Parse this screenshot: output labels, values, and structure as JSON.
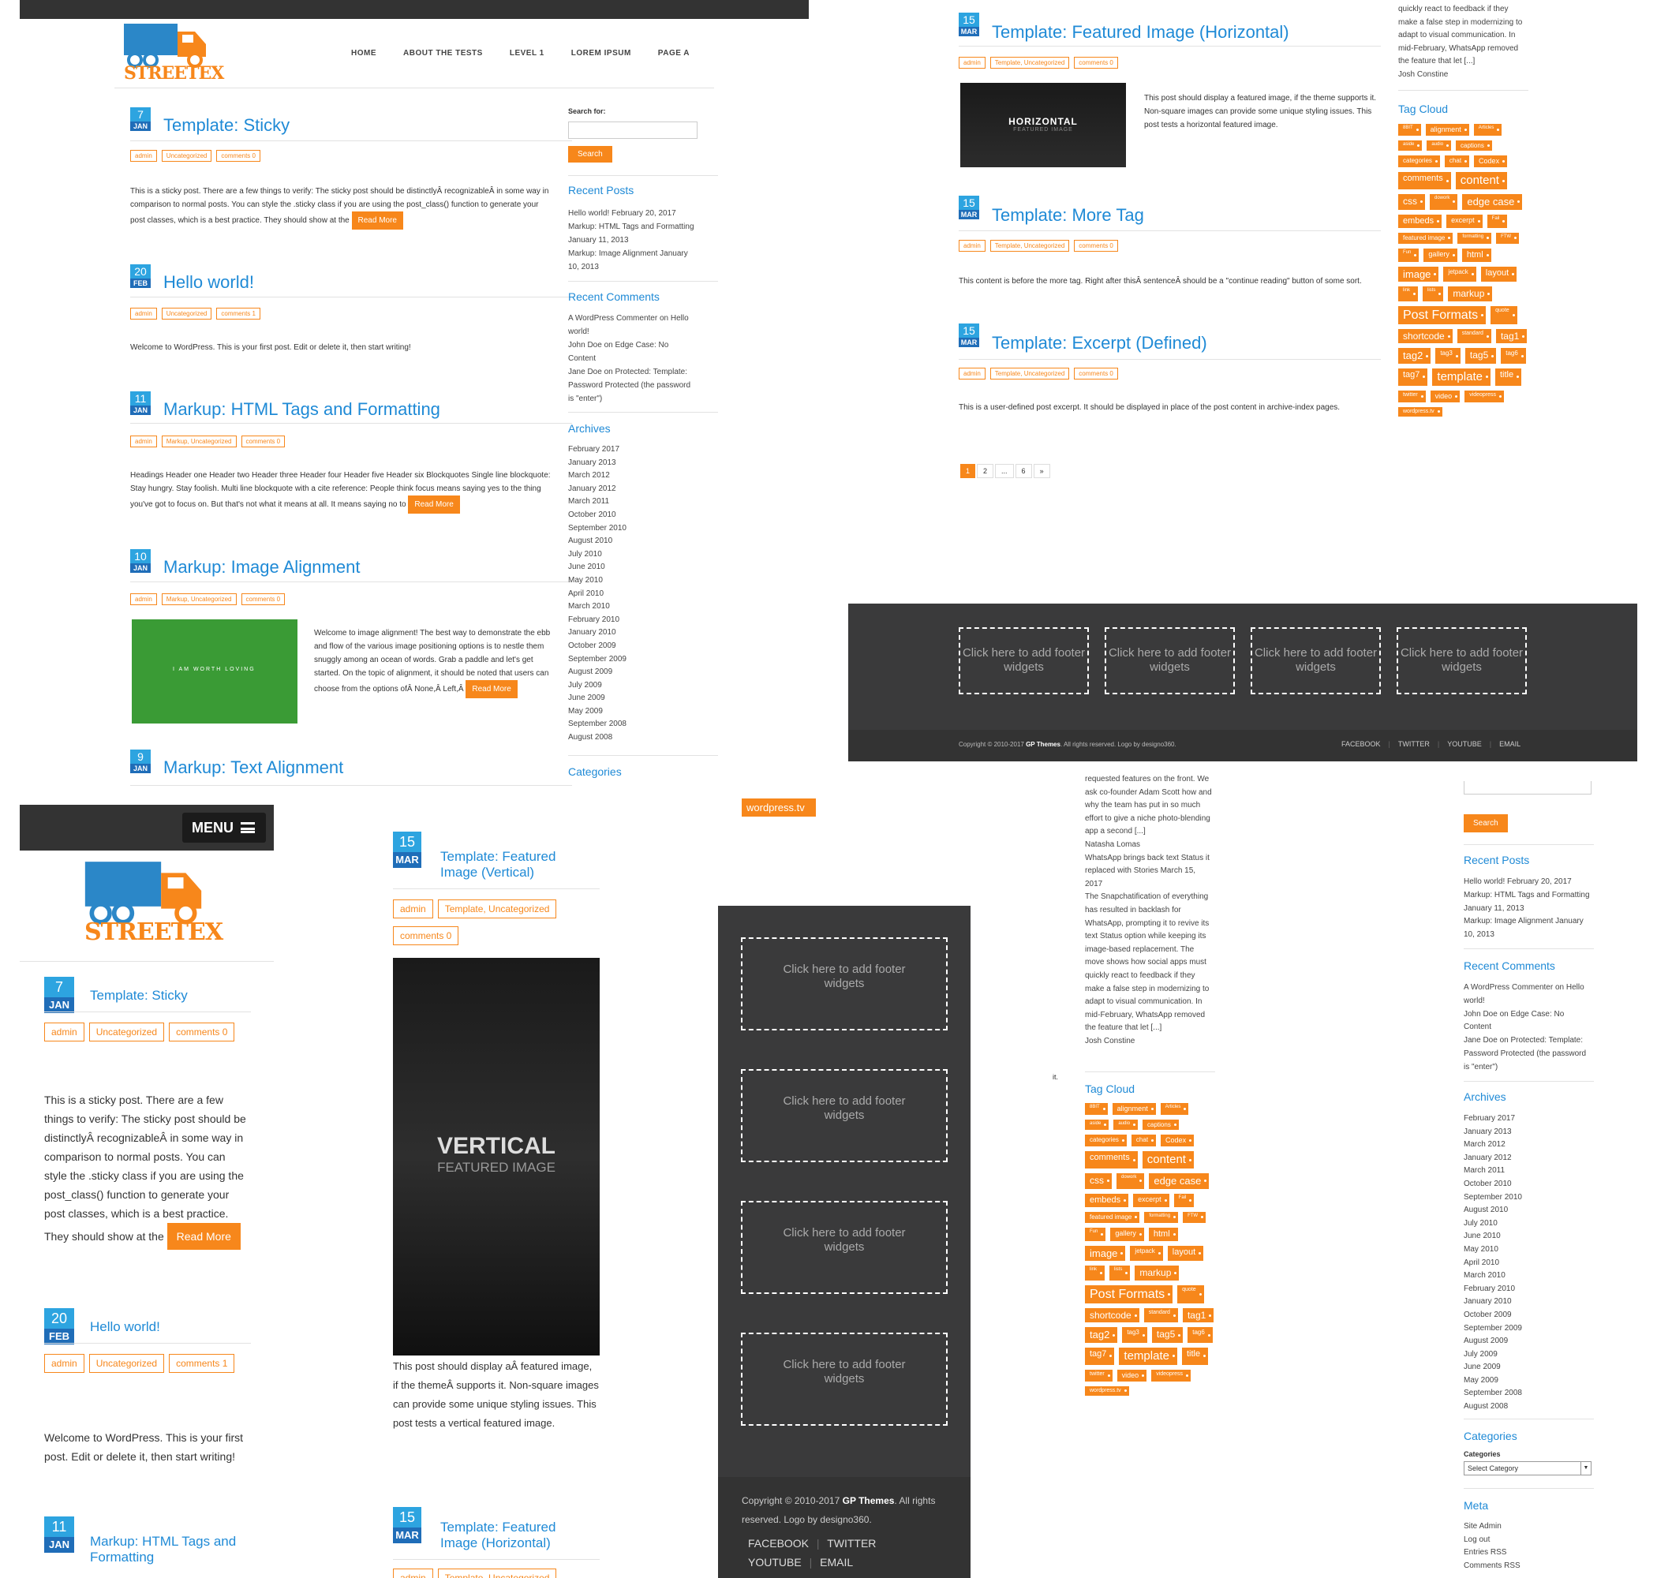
{
  "panel1": {
    "logo_text": "STREETEX",
    "nav": [
      "HOME",
      "ABOUT THE TESTS",
      "LEVEL 1",
      "LOREM IPSUM",
      "PAGE A"
    ],
    "posts": [
      {
        "day": "7",
        "month": "JAN",
        "title": "Template: Sticky",
        "meta": [
          "admin",
          "Uncategorized",
          "comments 0"
        ],
        "excerpt": "This is a sticky post. There are a few things to verify: The sticky post should be distinctlyÂ recognizableÂ in some way in comparison to normal posts. You can style the .sticky class if you are using the post_class() function to generate your post classes, which is a best practice. They should show at the",
        "more": "Read More"
      },
      {
        "day": "20",
        "month": "FEB",
        "title": "Hello world!",
        "meta": [
          "admin",
          "Uncategorized",
          "comments 1"
        ],
        "excerpt": "Welcome to WordPress. This is your first post. Edit or delete it, then start writing!",
        "more": ""
      },
      {
        "day": "11",
        "month": "JAN",
        "title": "Markup: HTML Tags and Formatting",
        "meta": [
          "admin",
          "Markup, Uncategorized",
          "comments 0"
        ],
        "excerpt": "Headings Header one Header two Header three Header four Header five Header six Blockquotes Single line blockquote: Stay hungry. Stay foolish. Multi line blockquote with a cite reference: People think focus means saying yes to the thing you've got to focus on. But that's not what it means at all. It means saying no to",
        "more": "Read More"
      },
      {
        "day": "10",
        "month": "JAN",
        "title": "Markup: Image Alignment",
        "meta": [
          "admin",
          "Markup, Uncategorized",
          "comments 0"
        ],
        "excerpt": "Welcome to image alignment! The best way to demonstrate the ebb and flow of the various image positioning options is to nestle them snuggly among an ocean of words. Grab a paddle and let's get started. On the topic of alignment, it should be noted that users can choose from the options ofÂ None,Â Left,Â",
        "more": "Read More",
        "image_text": "I AM WORTH LOVING"
      },
      {
        "day": "9",
        "month": "JAN",
        "title": "Markup: Text Alignment"
      }
    ],
    "sidebar": {
      "search_label": "Search for:",
      "search_button": "Search",
      "recent_posts_title": "Recent Posts",
      "recent_posts": [
        "Hello world! February 20, 2017",
        "Markup: HTML Tags and Formatting",
        "January 11, 2013",
        "Markup: Image Alignment January",
        "10, 2013"
      ],
      "recent_comments_title": "Recent Comments",
      "recent_comments": [
        "A WordPress Commenter on Hello",
        "world!",
        "John Doe on Edge Case: No",
        "Content",
        "Jane Doe on Protected: Template:",
        "Password Protected (the password",
        "is \"enter\")"
      ],
      "archives_title": "Archives",
      "archives": [
        "February 2017",
        "January 2013",
        "March 2012",
        "January 2012",
        "March 2011",
        "October 2010",
        "September 2010",
        "August 2010",
        "July 2010",
        "June 2010",
        "May 2010",
        "April 2010",
        "March 2010",
        "February 2010",
        "January 2010",
        "October 2009",
        "September 2009",
        "August 2009",
        "July 2009",
        "June 2009",
        "May 2009",
        "September 2008",
        "August 2008"
      ],
      "categories_title": "Categories"
    }
  },
  "panel2": {
    "posts": [
      {
        "day": "15",
        "month": "MAR",
        "title": "Template: Featured Image (Horizontal)",
        "meta": [
          "admin",
          "Template, Uncategorized",
          "comments 0"
        ],
        "excerpt": "This post should display a featured image, if the theme supports it. Non-square images can provide some unique styling issues. This post tests a horizontal featured image.",
        "image_title": "HORIZONTAL",
        "image_sub": "FEATURED IMAGE"
      },
      {
        "day": "15",
        "month": "MAR",
        "title": "Template: More Tag",
        "meta": [
          "admin",
          "Template, Uncategorized",
          "comments 0"
        ],
        "excerpt": "This content is before the more tag. Right after thisÂ sentenceÂ should be a \"continue reading\" button of some sort."
      },
      {
        "day": "15",
        "month": "MAR",
        "title": "Template: Excerpt (Defined)",
        "meta": [
          "admin",
          "Template, Uncategorized",
          "comments 0"
        ],
        "excerpt": "This is a user-defined post excerpt. It should be displayed in place of the post content in archive-index pages."
      }
    ],
    "pagination": [
      "1",
      "2",
      "...",
      "6",
      "»"
    ],
    "rss_tail": [
      "quickly react to feedback if they",
      "make a false step in modernizing to",
      "adapt to visual communication. In",
      "mid-February, WhatsApp removed",
      "the feature that let [...]",
      "Josh Constine"
    ],
    "tag_cloud_title": "Tag Cloud"
  },
  "tags": [
    {
      "t": "8BIT",
      "s": 6
    },
    {
      "t": "alignment",
      "s": 9
    },
    {
      "t": "Articles",
      "s": 6
    },
    {
      "t": "aside",
      "s": 6
    },
    {
      "t": "audio",
      "s": 6
    },
    {
      "t": "captions",
      "s": 8
    },
    {
      "t": "categories",
      "s": 8
    },
    {
      "t": "chat",
      "s": 8
    },
    {
      "t": "Codex",
      "s": 9
    },
    {
      "t": "comments",
      "s": 11
    },
    {
      "t": "content",
      "s": 15
    },
    {
      "t": "css",
      "s": 12
    },
    {
      "t": "dowork",
      "s": 6
    },
    {
      "t": "edge case",
      "s": 13
    },
    {
      "t": "embeds",
      "s": 11
    },
    {
      "t": "excerpt",
      "s": 9
    },
    {
      "t": "Fail",
      "s": 6
    },
    {
      "t": "featured image",
      "s": 8
    },
    {
      "t": "formatting",
      "s": 6
    },
    {
      "t": "FTW",
      "s": 6
    },
    {
      "t": "Fun",
      "s": 6
    },
    {
      "t": "gallery",
      "s": 9
    },
    {
      "t": "html",
      "s": 11
    },
    {
      "t": "image",
      "s": 13
    },
    {
      "t": "jetpack",
      "s": 8
    },
    {
      "t": "layout",
      "s": 11
    },
    {
      "t": "link",
      "s": 6
    },
    {
      "t": "lists",
      "s": 6
    },
    {
      "t": "markup",
      "s": 12
    },
    {
      "t": "Post Formats",
      "s": 16
    },
    {
      "t": "quote",
      "s": 7
    },
    {
      "t": "shortcode",
      "s": 12
    },
    {
      "t": "standard",
      "s": 7
    },
    {
      "t": "tag1",
      "s": 12
    },
    {
      "t": "tag2",
      "s": 13
    },
    {
      "t": "tag3",
      "s": 8
    },
    {
      "t": "tag5",
      "s": 12
    },
    {
      "t": "tag6",
      "s": 8
    },
    {
      "t": "tag7",
      "s": 11
    },
    {
      "t": "template",
      "s": 15
    },
    {
      "t": "title",
      "s": 11
    },
    {
      "t": "twitter",
      "s": 7
    },
    {
      "t": "video",
      "s": 9
    },
    {
      "t": "videopress",
      "s": 7
    },
    {
      "t": "wordpress.tv",
      "s": 7
    }
  ],
  "footer": {
    "widget_text": "Click here to add footer widgets",
    "copyright_pre": "Copyright © 2010-2017",
    "copyright_brand": "GP Themes",
    "copyright_post": ". All rights reserved. Logo by designo360.",
    "social": [
      "FACEBOOK",
      "TWITTER",
      "YOUTUBE",
      "EMAIL"
    ]
  },
  "panel3": {
    "menu_label": "MENU",
    "posts": [
      {
        "day": "7",
        "month": "JAN",
        "title": "Template: Sticky",
        "meta": [
          "admin",
          "Uncategorized",
          "comments 0"
        ],
        "excerpt": "This is a sticky post. There are a few things to verify: The sticky post should be distinctlyÂ recognizableÂ in some way in comparison to normal posts. You can style the .sticky class if you are using the post_class() function to generate your post classes, which is a best practice. They should show at the",
        "more": "Read More"
      },
      {
        "day": "20",
        "month": "FEB",
        "title": "Hello world!",
        "meta": [
          "admin",
          "Uncategorized",
          "comments 1"
        ],
        "excerpt": "Welcome to WordPress. This is your first post. Edit or delete it, then start writing!"
      },
      {
        "day": "11",
        "month": "JAN",
        "title": "Markup: HTML Tags and Formatting"
      }
    ]
  },
  "panel4": {
    "posts": [
      {
        "day": "15",
        "month": "MAR",
        "title": "Template: Featured Image (Vertical)",
        "meta": [
          "admin",
          "Template, Uncategorized",
          "comments 0"
        ],
        "excerpt": "This post should display aÂ featured image, if the themeÂ supports it. Non-square images can provide some unique styling issues. This post tests a vertical featured image.",
        "image_title": "VERTICAL",
        "image_sub": "FEATURED IMAGE"
      },
      {
        "day": "15",
        "month": "MAR",
        "title": "Template: Featured Image (Horizontal)",
        "meta": [
          "admin",
          "Template, Uncategorized"
        ]
      }
    ]
  },
  "panel5": {
    "top_tag": "wordpress.tv"
  },
  "panel7": {
    "rss_lines": [
      "requested features on the front. We",
      "ask co-founder Adam Scott how and",
      "why the team has put in so much",
      "effort to give a niche photo-blending",
      "app a second [...]",
      "Natasha Lomas",
      "WhatsApp brings back text Status it",
      "replaced with Stories March 15,",
      "2017",
      " The Snapchatification of everything",
      "has resulted in backlash for",
      "WhatsApp, prompting it to revive its",
      "text Status option while keeping its",
      "image-based replacement. The",
      "move shows how social apps must",
      "quickly react to feedback if they",
      "make a false step in modernizing to",
      "adapt to visual communication. In",
      "mid-February, WhatsApp removed",
      "the feature that let [...]",
      "Josh Constine"
    ],
    "stray": "it.",
    "tag_cloud_title": "Tag Cloud"
  },
  "panel8": {
    "search_button": "Search",
    "recent_posts_title": "Recent Posts",
    "recent_posts": [
      "Hello world! February 20, 2017",
      "Markup: HTML Tags and Formatting",
      "January 11, 2013",
      "Markup: Image Alignment January",
      "10, 2013"
    ],
    "recent_comments_title": "Recent Comments",
    "recent_comments": [
      "A WordPress Commenter on Hello",
      "world!",
      "John Doe on Edge Case: No",
      "Content",
      "Jane Doe on Protected: Template:",
      "Password Protected (the password",
      "is \"enter\")"
    ],
    "archives_title": "Archives",
    "archives": [
      "February 2017",
      "January 2013",
      "March 2012",
      "January 2012",
      "March 2011",
      "October 2010",
      "September 2010",
      "August 2010",
      "July 2010",
      "June 2010",
      "May 2010",
      "April 2010",
      "March 2010",
      "February 2010",
      "January 2010",
      "October 2009",
      "September 2009",
      "August 2009",
      "July 2009",
      "June 2009",
      "May 2009",
      "September 2008",
      "August 2008"
    ],
    "categories_title": "Categories",
    "categories_label": "Categories",
    "categories_select": "Select Category",
    "meta_title": "Meta",
    "meta_links": [
      "Site Admin",
      "Log out",
      "Entries RSS",
      "Comments RSS"
    ]
  },
  "colors": {
    "accent": "#f7871b",
    "link": "#1f8ad6",
    "date": "#2da4e0",
    "dark": "#3a3a3b"
  }
}
